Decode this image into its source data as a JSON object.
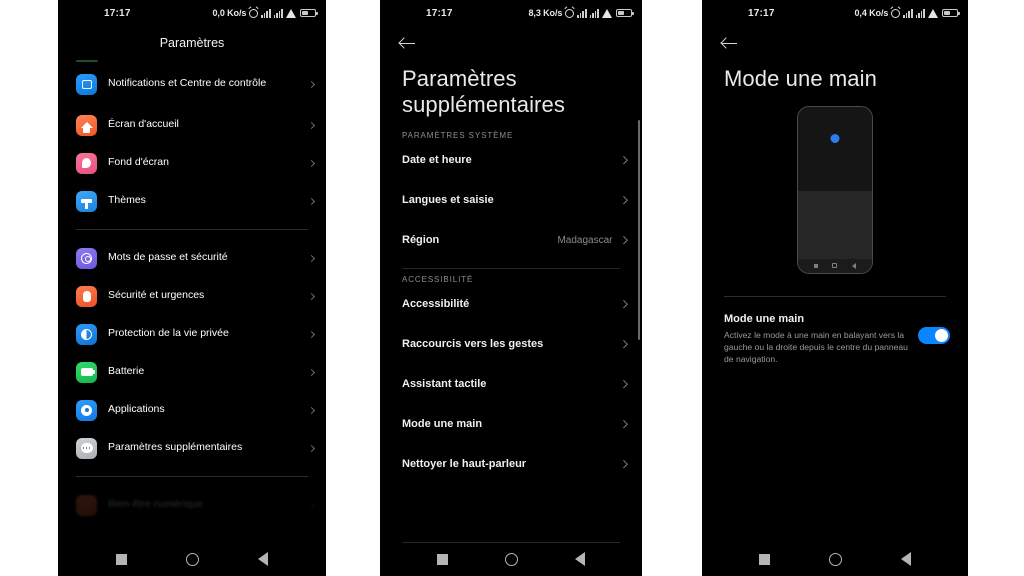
{
  "panel1": {
    "status_bar": {
      "time": "17:17",
      "network_speed": "0,0 Ko/s",
      "icons": [
        "alarm-icon",
        "signal-bars-icon",
        "signal-bars-icon",
        "wifi-icon",
        "battery-icon"
      ]
    },
    "title": "Paramètres",
    "items": [
      {
        "label": "Notifications et Centre de contrôle",
        "icon": "notifications-icon",
        "icon_class": "g-notif",
        "glyph": "gl-notif",
        "tall": true
      },
      {
        "label": "Écran d'accueil",
        "icon": "home-screen-icon",
        "icon_class": "g-home",
        "glyph": "gl-home",
        "tall": false
      },
      {
        "label": "Fond d'écran",
        "icon": "wallpaper-icon",
        "icon_class": "g-wall",
        "glyph": "gl-wall",
        "tall": false
      },
      {
        "label": "Thèmes",
        "icon": "themes-icon",
        "icon_class": "g-theme",
        "glyph": "gl-theme",
        "tall": false
      }
    ],
    "items2": [
      {
        "label": "Mots de passe et sécurité",
        "icon": "passwords-security-icon",
        "icon_class": "g-pass",
        "glyph": "gl-pass"
      },
      {
        "label": "Sécurité et urgences",
        "icon": "safety-emergency-icon",
        "icon_class": "g-secu",
        "glyph": "gl-secu"
      },
      {
        "label": "Protection de la vie privée",
        "icon": "privacy-icon",
        "icon_class": "g-privacy",
        "glyph": "gl-priv"
      },
      {
        "label": "Batterie",
        "icon": "battery-icon",
        "icon_class": "g-batt",
        "glyph": "gl-batt"
      },
      {
        "label": "Applications",
        "icon": "applications-icon",
        "icon_class": "g-apps",
        "glyph": "gl-apps"
      },
      {
        "label": "Paramètres supplémentaires",
        "icon": "additional-settings-icon",
        "icon_class": "g-more",
        "glyph": "gl-more"
      }
    ],
    "cut_off_item": {
      "label": "Bien-être numérique"
    }
  },
  "panel2": {
    "status_bar": {
      "time": "17:17",
      "network_speed": "8,3 Ko/s"
    },
    "back_label": "back-arrow",
    "title": "Paramètres supplémentaires",
    "section1_header": "PARAMÈTRES SYSTÈME",
    "section1_items": [
      {
        "label": "Date et heure",
        "value": ""
      },
      {
        "label": "Langues et saisie",
        "value": ""
      },
      {
        "label": "Région",
        "value": "Madagascar"
      }
    ],
    "section2_header": "ACCESSIBILITÉ",
    "section2_items": [
      {
        "label": "Accessibilité",
        "value": ""
      },
      {
        "label": "Raccourcis vers les gestes",
        "value": ""
      },
      {
        "label": "Assistant tactile",
        "value": ""
      },
      {
        "label": "Mode une main",
        "value": ""
      },
      {
        "label": "Nettoyer le haut-parleur",
        "value": ""
      }
    ]
  },
  "panel3": {
    "status_bar": {
      "time": "17:17",
      "network_speed": "0,4 Ko/s"
    },
    "title": "Mode une main",
    "illustration": "one-handed-mode-phone-illustration",
    "setting": {
      "title": "Mode une main",
      "description": "Activez le mode à une main en balayant vers la gauche ou la droite depuis le centre du panneau de navigation.",
      "toggle_state": "on",
      "toggle_color": "#0a84ff"
    }
  },
  "navbar": {
    "recents": "recents-square-icon",
    "home": "home-circle-icon",
    "back": "back-triangle-icon"
  },
  "theme": {
    "background": "#000000",
    "page_background": "#ffffff",
    "text_primary": "#ffffff",
    "text_secondary": "#8e8e8e",
    "accent": "#0a84ff"
  }
}
